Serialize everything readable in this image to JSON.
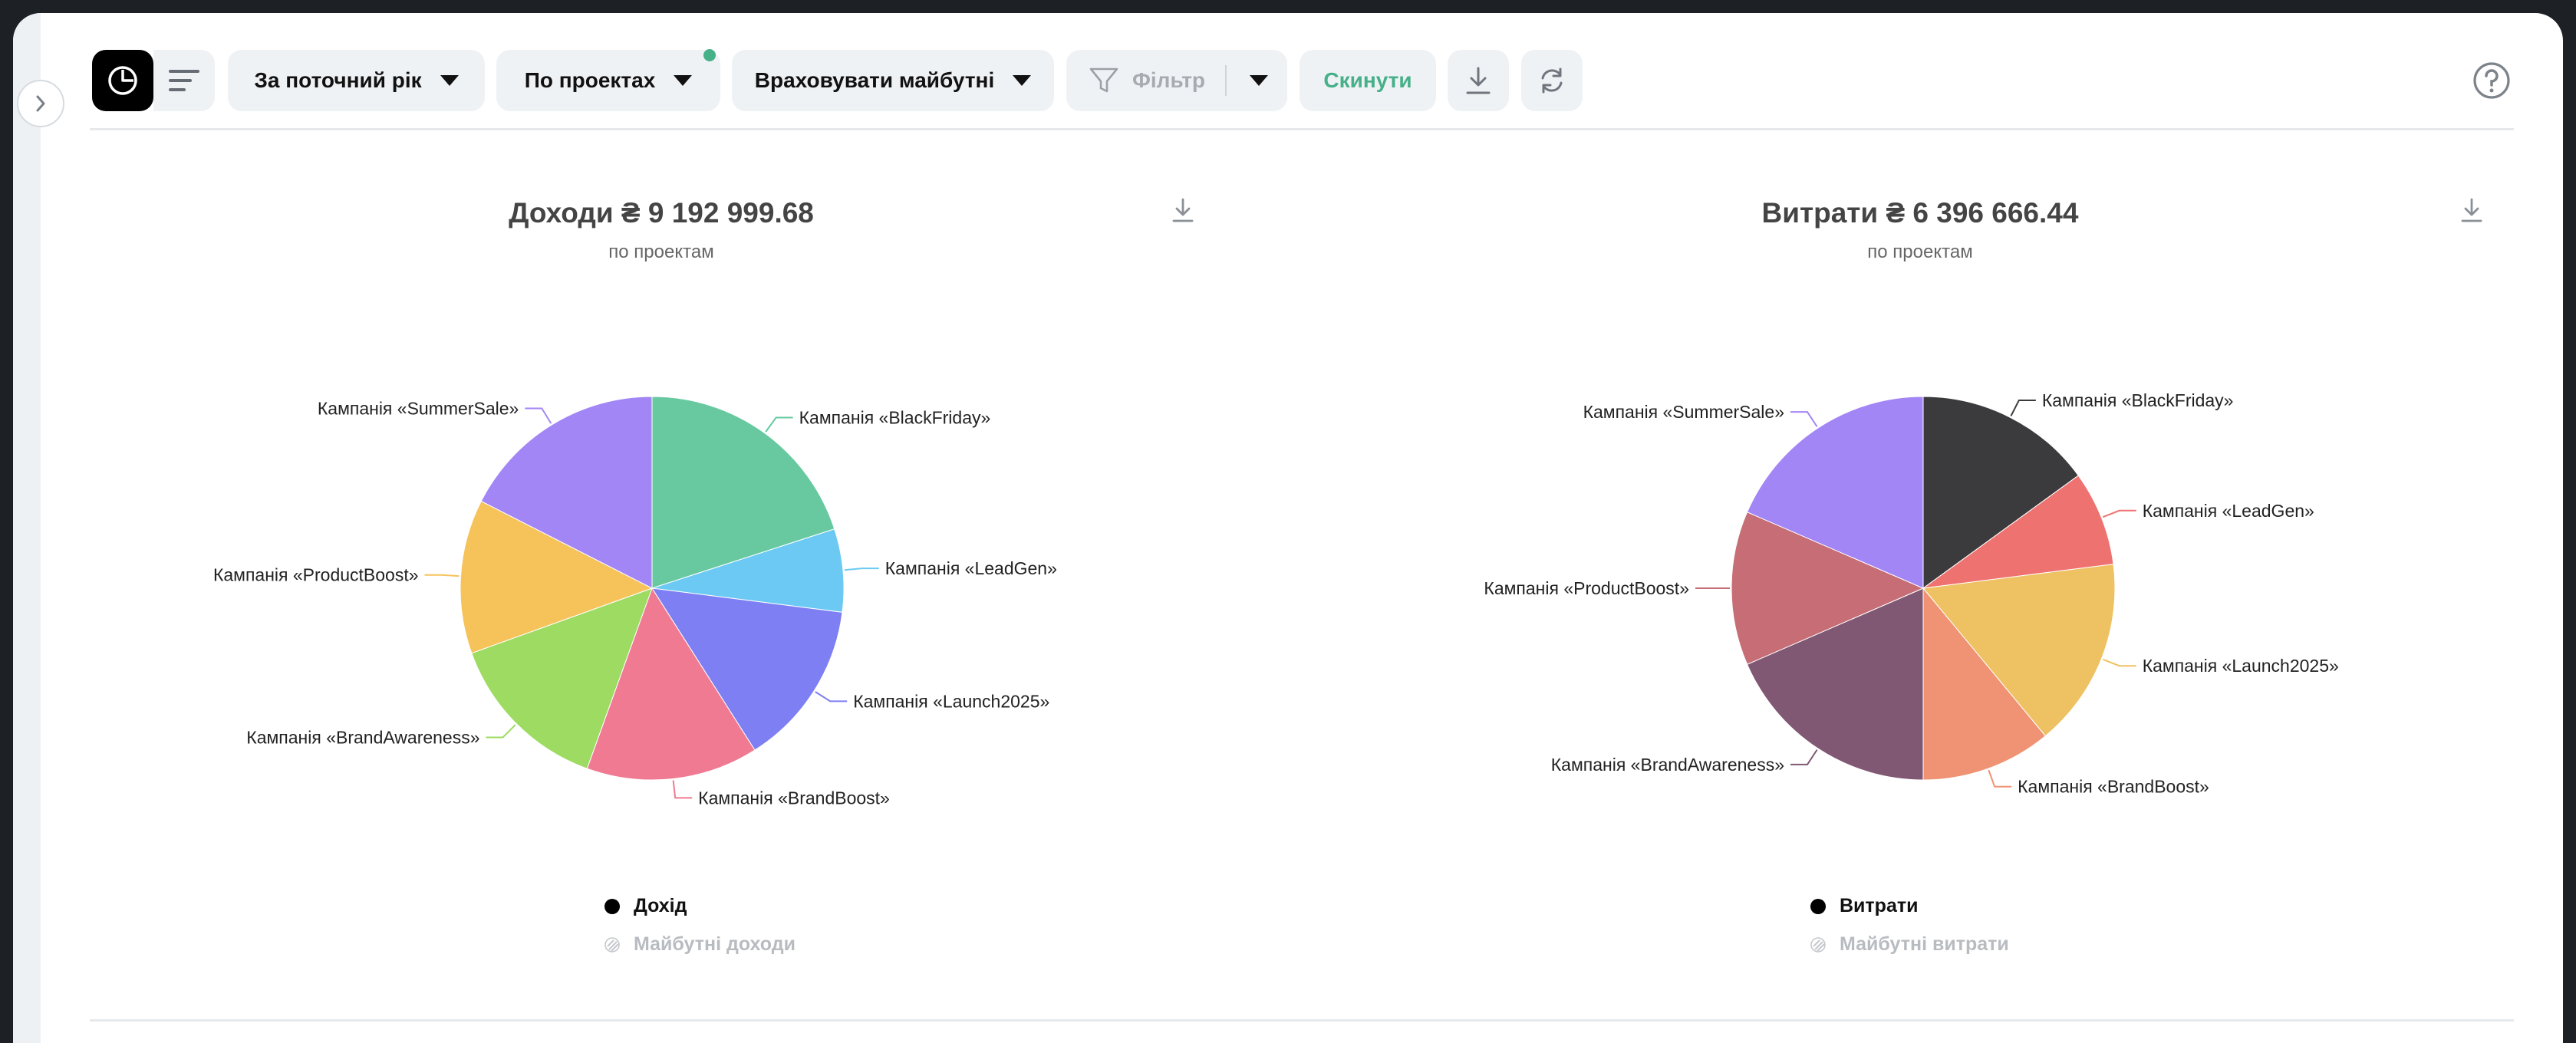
{
  "toolbar": {
    "period_label": "За поточний рік",
    "group_label": "По проектах",
    "future_label": "Враховувати майбутні",
    "filter_label": "Фільтр",
    "reset_label": "Скинути"
  },
  "colors": {
    "accent_green": "#46b089"
  },
  "charts": {
    "income": {
      "title": "Доходи ₴ 9 192 999.68",
      "subtitle": "по проектам",
      "legend_main": "Дохід",
      "legend_future": "Майбутні доходи"
    },
    "expense": {
      "title": "Витрати ₴ 6 396 666.44",
      "subtitle": "по проектам",
      "legend_main": "Витрати",
      "legend_future": "Майбутні витрати"
    }
  },
  "chart_data": [
    {
      "type": "pie",
      "title": "Доходи ₴ 9 192 999.68",
      "subtitle": "по проектам",
      "legend": [
        "Дохід",
        "Майбутні доходи"
      ],
      "series": [
        {
          "name": "Кампанія «BlackFriday»",
          "value": 20.0,
          "color": "#68c9a1"
        },
        {
          "name": "Кампанія «LeadGen»",
          "value": 7.0,
          "color": "#6cc9f3"
        },
        {
          "name": "Кампанія «Launch2025»",
          "value": 14.0,
          "color": "#7e7ff2"
        },
        {
          "name": "Кампанія «BrandBoost»",
          "value": 14.5,
          "color": "#ef7a92"
        },
        {
          "name": "Кампанія «BrandAwareness»",
          "value": 14.0,
          "color": "#9edb62"
        },
        {
          "name": "Кампанія «ProductBoost»",
          "value": 13.0,
          "color": "#f6c35a"
        },
        {
          "name": "Кампанія «SummerSale»",
          "value": 17.5,
          "color": "#a386f5"
        }
      ]
    },
    {
      "type": "pie",
      "title": "Витрати ₴ 6 396 666.44",
      "subtitle": "по проектам",
      "legend": [
        "Витрати",
        "Майбутні витрати"
      ],
      "series": [
        {
          "name": "Кампанія «BlackFriday»",
          "value": 15.0,
          "color": "#3b3b3d"
        },
        {
          "name": "Кампанія «LeadGen»",
          "value": 8.0,
          "color": "#ee7370"
        },
        {
          "name": "Кампанія «Launch2025»",
          "value": 16.0,
          "color": "#eec262"
        },
        {
          "name": "Кампанія «BrandBoost»",
          "value": 11.0,
          "color": "#f09374"
        },
        {
          "name": "Кампанія «BrandAwareness»",
          "value": 18.5,
          "color": "#815873"
        },
        {
          "name": "Кампанія «ProductBoost»",
          "value": 13.0,
          "color": "#c66d76"
        },
        {
          "name": "Кампанія «SummerSale»",
          "value": 18.5,
          "color": "#a386f5"
        }
      ]
    }
  ]
}
